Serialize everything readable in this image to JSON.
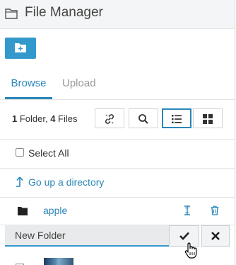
{
  "header": {
    "title": "File Manager",
    "icon": "folder-outline-icon"
  },
  "toolbar": {
    "new_folder_icon": "folder-plus-icon",
    "folder_count": "1",
    "folder_label": " Folder, ",
    "file_count": "4",
    "file_label": " Files",
    "buttons": [
      "link-icon",
      "search-icon",
      "list-view-icon",
      "grid-view-icon"
    ],
    "active_view": "list"
  },
  "tabs": [
    {
      "label": "Browse",
      "active": true
    },
    {
      "label": "Upload",
      "active": false
    }
  ],
  "select_all": {
    "label": "Select All",
    "checked": false
  },
  "go_up": {
    "label": "Go up a directory",
    "icon": "up-arrow-icon"
  },
  "items": [
    {
      "type": "folder",
      "name": "apple",
      "icons": [
        "rename-icon",
        "trash-icon"
      ]
    }
  ],
  "new_folder": {
    "value": "New Folder",
    "confirm_icon": "check-icon",
    "cancel_icon": "close-icon"
  },
  "colors": {
    "accent": "#2a86b8",
    "button": "#3399cc",
    "header_bg": "#f4f5f6"
  }
}
